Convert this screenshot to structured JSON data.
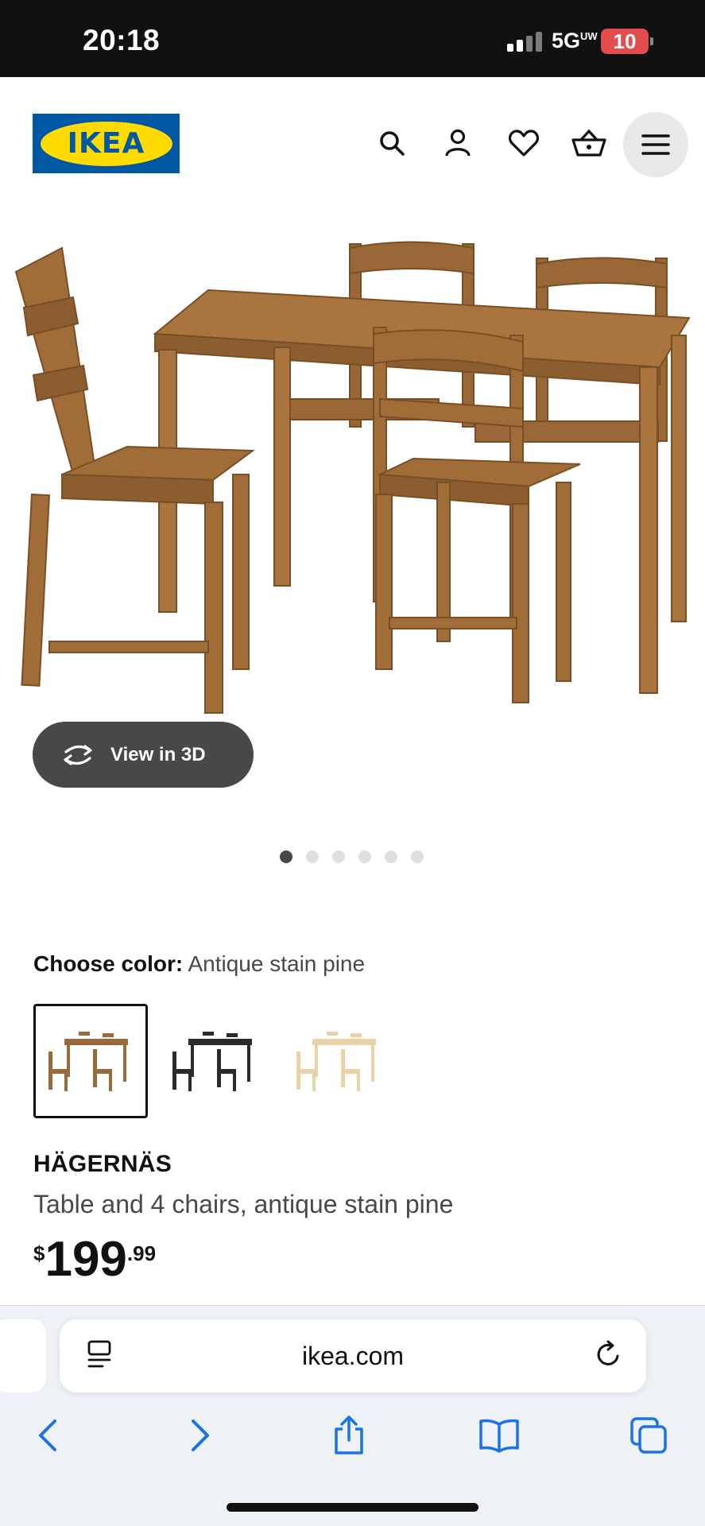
{
  "status_bar": {
    "time": "20:18",
    "network": "5G",
    "network_suffix": "UW",
    "battery": "10"
  },
  "header": {
    "logo_text": "IKEA",
    "icons": [
      "search-icon",
      "account-icon",
      "heart-icon",
      "basket-icon",
      "menu-icon"
    ]
  },
  "gallery": {
    "view_3d_label": "View in 3D",
    "dot_count": 6,
    "active_index": 0
  },
  "color_chooser": {
    "label": "Choose color:",
    "value": "Antique stain pine",
    "swatches": [
      {
        "name": "antique-stain-pine",
        "color": "#9b6a3a",
        "selected": true
      },
      {
        "name": "black-brown",
        "color": "#2b2b2b",
        "selected": false
      },
      {
        "name": "pine",
        "color": "#e8d2a6",
        "selected": false
      }
    ]
  },
  "product": {
    "name": "HÄGERNÄS",
    "description": "Table and 4 chairs, antique stain pine",
    "price_currency": "$",
    "price_integer": "199",
    "price_decimal": ".99"
  },
  "browser": {
    "url": "ikea.com",
    "icons": [
      "back-icon",
      "forward-icon",
      "share-icon",
      "bookmarks-icon",
      "tabs-icon"
    ]
  },
  "colors": {
    "ikea_blue": "#0058a3",
    "ikea_yellow": "#ffdb00",
    "safari_blue": "#1a73e8"
  }
}
